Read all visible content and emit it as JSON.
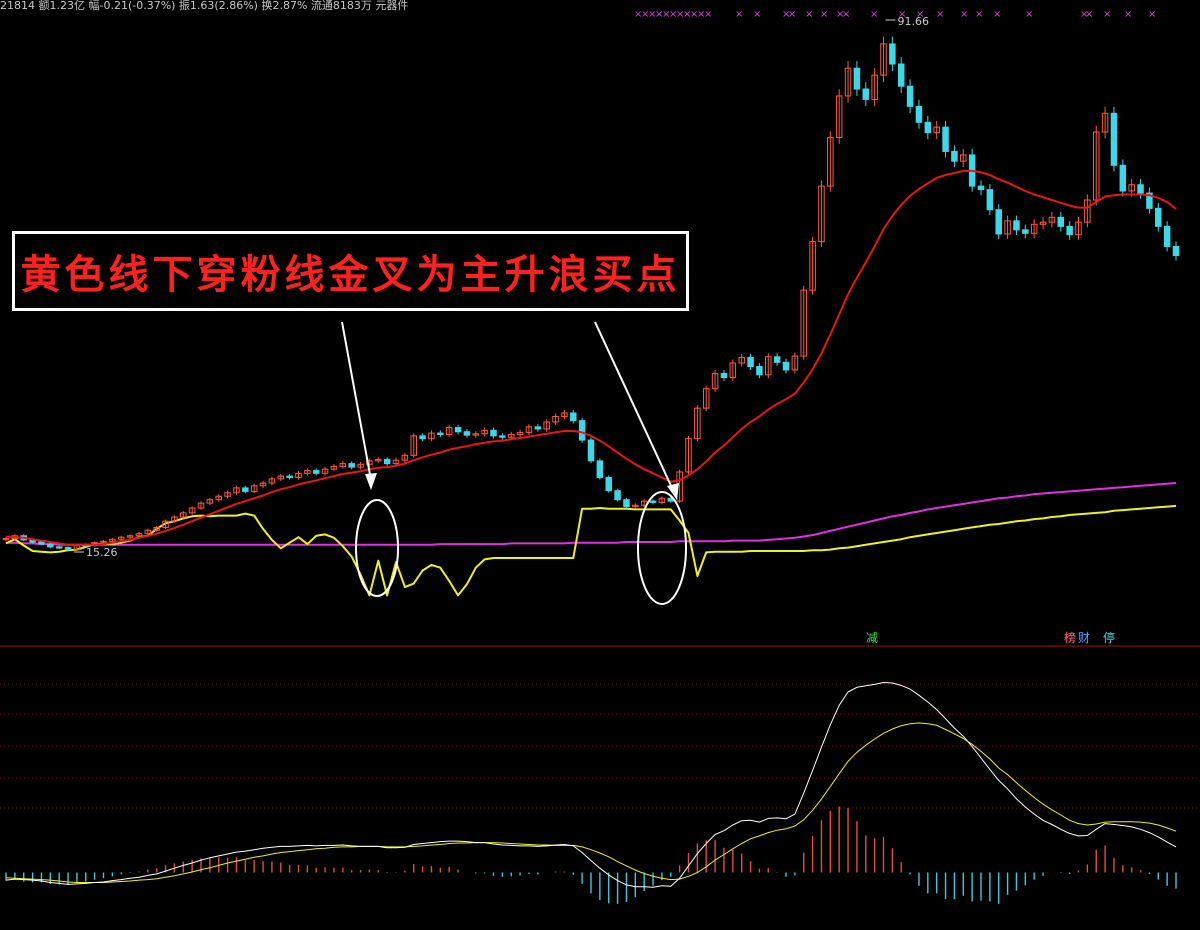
{
  "header": {
    "partial_text": "21814 额1.23亿 幅-0.21(-0.37%) 振1.63(2.86%) 换2.87% 流通8183万 元器件"
  },
  "annotation": {
    "callout_text": "黄色线下穿粉线金叉为主升浪买点"
  },
  "markers": {
    "sell_tag": "减",
    "bang_tag": "榜",
    "cai_tag": "财",
    "ting_tag": "停",
    "cross_marks": "×"
  },
  "colors": {
    "background": "#000000",
    "candle_up": "#ff5a3c",
    "candle_down": "#3dd8e8",
    "ma_short": "#e8161a",
    "ma_long": "#e030e0",
    "signal_line": "#f0f020",
    "macd_dif": "#ffffff",
    "macd_dea": "#f0f020",
    "macd_pos": "#e0503c",
    "macd_neg": "#40c8e0",
    "divider": "#a01010"
  },
  "chart_data": [
    {
      "type": "candlestick",
      "price_labels": {
        "high": "91.66",
        "low": "15.26"
      },
      "closes": [
        17.2,
        17.6,
        17.0,
        16.7,
        16.4,
        16.0,
        15.9,
        15.6,
        16.3,
        16.2,
        16.6,
        16.8,
        17.1,
        17.4,
        17.6,
        17.9,
        18.4,
        18.8,
        19.7,
        20.3,
        20.9,
        21.6,
        22.3,
        22.8,
        23.3,
        23.8,
        24.5,
        24.0,
        24.8,
        25.2,
        25.8,
        26.2,
        26.0,
        26.6,
        27.0,
        26.6,
        27.2,
        27.6,
        28.0,
        27.5,
        27.9,
        28.4,
        28.6,
        28.0,
        28.5,
        29.2,
        32.0,
        31.6,
        32.4,
        32.2,
        33.2,
        32.6,
        32.1,
        32.3,
        32.8,
        32.0,
        31.8,
        32.2,
        32.5,
        33.3,
        33.0,
        34.0,
        34.8,
        35.3,
        34.2,
        31.4,
        28.4,
        26.0,
        24.1,
        22.8,
        21.8,
        22.0,
        22.6,
        22.4,
        23.0,
        22.6,
        26.8,
        31.6,
        36.0,
        38.8,
        41.0,
        40.4,
        42.5,
        43.3,
        42.0,
        40.8,
        43.4,
        42.6,
        41.5,
        43.5,
        53.0,
        60.0,
        68.0,
        75.0,
        81.0,
        85.0,
        82.0,
        80.5,
        84.0,
        88.5,
        85.6,
        82.4,
        79.5,
        77.2,
        75.7,
        76.5,
        73.0,
        71.6,
        72.5,
        68.0,
        67.5,
        64.6,
        61.1,
        63.0,
        61.7,
        61.2,
        62.5,
        62.8,
        63.5,
        62.2,
        61.0,
        62.8,
        66.0,
        75.8,
        78.5,
        71.0,
        67.3,
        68.2,
        67.0,
        64.8,
        62.2,
        59.3,
        58.0
      ],
      "ma_short": [
        17.5,
        17.4,
        17.3,
        17.1,
        16.9,
        16.7,
        16.5,
        16.3,
        16.3,
        16.3,
        16.3,
        16.4,
        16.6,
        16.8,
        17.0,
        17.3,
        17.6,
        17.9,
        18.3,
        18.7,
        19.2,
        19.7,
        20.2,
        20.7,
        21.2,
        21.7,
        22.2,
        22.6,
        23.0,
        23.4,
        23.9,
        24.3,
        24.6,
        25.0,
        25.3,
        25.6,
        25.9,
        26.2,
        26.5,
        26.7,
        26.9,
        27.2,
        27.4,
        27.5,
        27.7,
        28.0,
        28.5,
        28.9,
        29.3,
        29.6,
        30.0,
        30.3,
        30.5,
        30.8,
        31.0,
        31.2,
        31.3,
        31.5,
        31.7,
        31.9,
        32.1,
        32.3,
        32.5,
        32.7,
        32.7,
        32.5,
        32.0,
        31.3,
        30.5,
        29.6,
        28.7,
        27.9,
        27.2,
        26.6,
        26.0,
        25.4,
        25.6,
        26.3,
        27.2,
        28.3,
        29.6,
        30.6,
        31.8,
        33.0,
        34.0,
        34.8,
        35.8,
        36.6,
        37.3,
        38.1,
        39.7,
        41.6,
        43.9,
        46.6,
        49.5,
        52.4,
        54.8,
        57.0,
        59.3,
        61.8,
        63.7,
        65.3,
        66.6,
        67.6,
        68.4,
        69.2,
        69.6,
        69.9,
        70.2,
        70.2,
        70.0,
        69.6,
        69.0,
        68.5,
        67.9,
        67.3,
        66.8,
        66.4,
        66.0,
        65.6,
        65.2,
        64.9,
        64.9,
        65.7,
        66.5,
        66.7,
        66.8,
        66.8,
        66.8,
        66.7,
        66.3,
        65.7,
        64.7
      ],
      "ma_long": [
        16.6,
        16.6,
        16.5,
        16.5,
        16.4,
        16.4,
        16.3,
        16.3,
        16.3,
        16.3,
        16.3,
        16.3,
        16.3,
        16.3,
        16.3,
        16.3,
        16.3,
        16.3,
        16.3,
        16.3,
        16.3,
        16.3,
        16.3,
        16.3,
        16.3,
        16.3,
        16.3,
        16.3,
        16.3,
        16.3,
        16.3,
        16.3,
        16.3,
        16.3,
        16.3,
        16.3,
        16.3,
        16.3,
        16.3,
        16.3,
        16.3,
        16.3,
        16.3,
        16.3,
        16.3,
        16.3,
        16.3,
        16.3,
        16.3,
        16.4,
        16.4,
        16.4,
        16.4,
        16.4,
        16.4,
        16.4,
        16.4,
        16.5,
        16.5,
        16.5,
        16.5,
        16.5,
        16.5,
        16.5,
        16.6,
        16.6,
        16.6,
        16.6,
        16.6,
        16.6,
        16.7,
        16.7,
        16.7,
        16.7,
        16.7,
        16.7,
        16.8,
        16.8,
        16.8,
        16.8,
        16.8,
        16.8,
        16.9,
        16.9,
        16.9,
        16.9,
        17.0,
        17.1,
        17.2,
        17.3,
        17.5,
        17.7,
        18.0,
        18.3,
        18.6,
        18.9,
        19.2,
        19.5,
        19.8,
        20.1,
        20.4,
        20.6,
        20.9,
        21.1,
        21.4,
        21.6,
        21.8,
        22.0,
        22.2,
        22.4,
        22.6,
        22.8,
        23.0,
        23.1,
        23.3,
        23.4,
        23.6,
        23.7,
        23.8,
        23.9,
        24.0,
        24.1,
        24.2,
        24.3,
        24.4,
        24.5,
        24.6,
        24.7,
        24.8,
        24.9,
        25.0,
        25.1,
        25.2
      ],
      "signal_line": [
        16.5,
        17.1,
        16.2,
        15.4,
        15.3,
        15.2,
        15.3,
        15.5,
        15.6,
        16.0,
        16.4,
        16.4,
        16.4,
        16.6,
        16.9,
        17.4,
        17.6,
        18.6,
        19.4,
        19.7,
        20.1,
        20.4,
        20.5,
        20.4,
        20.5,
        20.5,
        20.5,
        20.8,
        20.5,
        18.6,
        17.0,
        15.8,
        16.6,
        17.4,
        16.4,
        17.6,
        17.8,
        17.3,
        16.1,
        14.6,
        12.0,
        9.0,
        14.0,
        9.0,
        13.8,
        10.2,
        10.7,
        12.6,
        13.4,
        13.0,
        11.1,
        9.0,
        10.6,
        13.0,
        14.2,
        14.4,
        14.4,
        14.4,
        14.4,
        14.4,
        14.4,
        14.4,
        14.4,
        14.4,
        14.4,
        21.5,
        21.5,
        21.6,
        21.5,
        21.5,
        21.5,
        21.4,
        21.4,
        21.4,
        21.4,
        21.4,
        19.8,
        18.0,
        11.8,
        15.2,
        15.3,
        15.3,
        15.3,
        15.3,
        15.4,
        15.4,
        15.4,
        15.4,
        15.4,
        15.4,
        15.4,
        15.5,
        15.5,
        15.6,
        15.8,
        15.9,
        16.1,
        16.3,
        16.5,
        16.7,
        16.9,
        17.1,
        17.4,
        17.6,
        17.8,
        18.0,
        18.2,
        18.4,
        18.6,
        18.8,
        19.0,
        19.2,
        19.3,
        19.5,
        19.7,
        19.8,
        20.0,
        20.1,
        20.3,
        20.4,
        20.6,
        20.7,
        20.8,
        20.9,
        21.0,
        21.2,
        21.3,
        21.4,
        21.5,
        21.6,
        21.7,
        21.8,
        21.9
      ],
      "ylim": [
        15.26,
        91.66
      ]
    },
    {
      "type": "macd",
      "hist": [
        -1.7,
        -1.5,
        -1.9,
        -2.1,
        -2.1,
        -2.4,
        -2.5,
        -2.6,
        -2.1,
        -1.9,
        -1.5,
        -1.2,
        -0.8,
        -0.4,
        -0.1,
        0.2,
        0.6,
        0.9,
        1.5,
        1.9,
        2.3,
        2.7,
        3.0,
        3.2,
        3.2,
        3.1,
        3.2,
        2.6,
        2.6,
        2.4,
        2.3,
        2.1,
        1.6,
        1.6,
        1.5,
        1.0,
        1.1,
        1.0,
        1.0,
        0.5,
        0.5,
        0.6,
        0.5,
        -0.1,
        0.1,
        0.4,
        1.8,
        1.3,
        1.4,
        1.0,
        1.2,
        0.6,
        0.0,
        -0.2,
        -0.2,
        -0.7,
        -0.9,
        -0.8,
        -0.6,
        -0.3,
        -0.4,
        0.0,
        0.2,
        0.2,
        -0.5,
        -2.4,
        -4.4,
        -5.8,
        -6.5,
        -6.6,
        -6.2,
        -5.2,
        -3.9,
        -2.8,
        -1.6,
        -0.9,
        1.5,
        4.1,
        6.1,
        6.8,
        6.8,
        5.2,
        4.8,
        4.0,
        2.4,
        0.8,
        0.9,
        0.1,
        -0.9,
        -0.6,
        4.2,
        7.7,
        11.0,
        13.0,
        13.9,
        13.6,
        10.8,
        7.8,
        7.2,
        7.5,
        5.1,
        2.2,
        -0.4,
        -2.8,
        -4.4,
        -4.4,
        -5.6,
        -5.6,
        -4.9,
        -6.1,
        -5.9,
        -6.1,
        -6.6,
        -4.7,
        -3.8,
        -2.7,
        -1.5,
        -0.7,
        0.0,
        -0.1,
        -0.3,
        0.4,
        1.7,
        4.8,
        5.7,
        3.1,
        1.5,
        1.1,
        0.5,
        -0.3,
        -1.5,
        -2.8,
        -3.4
      ],
      "dif": [
        -1.6,
        -1.4,
        -1.5,
        -1.6,
        -1.8,
        -2.1,
        -2.3,
        -2.5,
        -2.4,
        -2.3,
        -2.1,
        -2.0,
        -1.7,
        -1.5,
        -1.2,
        -1.0,
        -0.6,
        -0.3,
        0.3,
        0.9,
        1.5,
        2.0,
        2.6,
        3.1,
        3.5,
        3.9,
        4.3,
        4.5,
        4.8,
        5.1,
        5.3,
        5.5,
        5.5,
        5.6,
        5.7,
        5.6,
        5.7,
        5.7,
        5.8,
        5.6,
        5.5,
        5.5,
        5.5,
        5.2,
        5.2,
        5.3,
        5.9,
        6.1,
        6.3,
        6.5,
        6.6,
        6.6,
        6.5,
        6.3,
        6.3,
        6.0,
        5.8,
        5.7,
        5.6,
        5.6,
        5.5,
        5.6,
        5.8,
        5.9,
        5.6,
        4.2,
        2.5,
        0.9,
        -0.5,
        -1.7,
        -2.6,
        -3.0,
        -3.0,
        -3.1,
        -2.8,
        -2.9,
        -1.2,
        1.4,
        4.0,
        6.1,
        8.0,
        8.8,
        10.0,
        10.9,
        11.0,
        10.6,
        11.4,
        11.5,
        11.3,
        12.3,
        16.7,
        21.5,
        26.4,
        31.1,
        35.2,
        38.0,
        39.0,
        39.3,
        39.6,
        40.0,
        39.9,
        39.4,
        38.6,
        37.3,
        35.9,
        34.3,
        32.4,
        30.4,
        28.7,
        26.5,
        24.1,
        21.7,
        19.4,
        17.6,
        15.5,
        13.8,
        12.3,
        11.0,
        10.1,
        9.1,
        8.2,
        7.7,
        7.8,
        9.1,
        10.3,
        10.1,
        9.9,
        9.6,
        9.1,
        8.4,
        7.5,
        6.4,
        5.4
      ],
      "dea": [
        -1.1,
        -1.2,
        -1.3,
        -1.4,
        -1.5,
        -1.6,
        -1.8,
        -2.0,
        -2.1,
        -2.1,
        -2.1,
        -2.1,
        -2.0,
        -1.9,
        -1.8,
        -1.6,
        -1.5,
        -1.3,
        -1.0,
        -0.7,
        -0.3,
        0.1,
        0.6,
        1.0,
        1.5,
        2.0,
        2.4,
        2.8,
        3.2,
        3.5,
        3.9,
        4.2,
        4.4,
        4.6,
        4.8,
        5.0,
        5.1,
        5.3,
        5.4,
        5.4,
        5.5,
        5.5,
        5.5,
        5.4,
        5.4,
        5.4,
        5.5,
        5.6,
        5.8,
        5.9,
        6.1,
        6.2,
        6.2,
        6.3,
        6.3,
        6.3,
        6.2,
        6.1,
        6.0,
        5.9,
        5.8,
        5.8,
        5.7,
        5.7,
        5.7,
        5.4,
        4.8,
        4.1,
        3.3,
        2.3,
        1.4,
        0.5,
        -0.2,
        -0.8,
        -1.2,
        -1.5,
        -1.4,
        -0.8,
        0.0,
        1.2,
        2.6,
        3.8,
        5.0,
        6.1,
        7.1,
        7.7,
        8.4,
        8.9,
        9.2,
        9.8,
        11.1,
        13.1,
        15.5,
        18.1,
        20.8,
        23.4,
        25.3,
        26.8,
        28.1,
        29.3,
        30.2,
        30.9,
        31.3,
        31.5,
        31.3,
        31.0,
        30.1,
        29.2,
        28.2,
        27.0,
        25.5,
        23.9,
        22,
        20.6,
        18.9,
        17.3,
        15.8,
        14.4,
        13.2,
        12.1,
        11.0,
        10.3,
        10.0,
        10.2,
        10.6,
        10.7,
        10.7,
        10.7,
        10.6,
        10.4,
        10.0,
        9.4,
        8.7
      ],
      "ylim": [
        -10,
        42
      ]
    }
  ]
}
